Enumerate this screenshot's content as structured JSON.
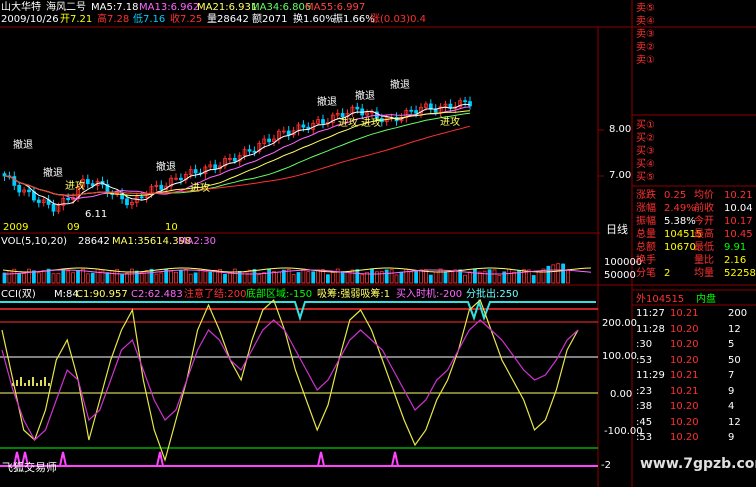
{
  "header": {
    "title": "山大华特",
    "formula": "海风二号",
    "ma5": "MA5:7.18",
    "ma13": "MA13:6.962",
    "ma21": "MA21:6.931",
    "ma34": "MA34:6.806",
    "ma55": "MA55:6.997",
    "date": "2009/10/26",
    "open": "开7.21",
    "high": "高7.28",
    "low": "低7.16",
    "close": "收7.25",
    "vol": "量28642",
    "amount": "额2071",
    "turnover": "换1.60%",
    "amplitude": "振1.66%",
    "change": "涨(0.03)0.4"
  },
  "price_panel": {
    "axis_labels": [
      "8.00",
      "7.00"
    ],
    "low_marker": "6.11",
    "x_labels": [
      "2009",
      "09",
      "10"
    ],
    "period": "日线",
    "annotations": [
      "撤退",
      "进攻",
      "撤退",
      "进攻",
      "撤退",
      "进攻",
      "撤退",
      "进攻",
      "撤退",
      "进攻",
      "撤退",
      "进攻"
    ]
  },
  "volume_panel": {
    "title": "VOL(5,10,20)",
    "value": "28642",
    "ma1": "MA1:35614.398",
    "ma2": "MA2:30",
    "axis_labels": [
      "100000",
      "50000"
    ]
  },
  "cci_panel": {
    "title": "CCI(双)",
    "m": "M:84",
    "c1": "C1:90.957",
    "c2": "C2:62.483",
    "warn": "注意了结:200",
    "bottom": "底部区域:-150",
    "absorb": "吸筹:强弱吸筹:1",
    "buy": "买入时机:-200",
    "sell": "分批出:250",
    "axis_labels": [
      "200.00",
      "100.00",
      "0.00",
      "-100.00",
      "-2"
    ],
    "watermark_left": "飞狐交易师",
    "watermark_right": "www.7gpzb.com"
  },
  "order_book": {
    "sells": [
      "卖⑤",
      "卖④",
      "卖③",
      "卖②",
      "卖①"
    ],
    "buys": [
      "买①",
      "买②",
      "买③",
      "买④",
      "买⑤"
    ],
    "stats": [
      {
        "k1": "涨跌",
        "v1": "0.25",
        "k2": "均价",
        "v2": "10.21",
        "c1": "#ff3030",
        "c2": "#ff3030"
      },
      {
        "k1": "涨幅",
        "v1": "2.49%",
        "k2": "前收",
        "v2": "10.04",
        "c1": "#ff3030",
        "c2": "#ffffff"
      },
      {
        "k1": "振幅",
        "v1": "5.38%",
        "k2": "今开",
        "v2": "10.17",
        "c1": "#ffffff",
        "c2": "#ff3030"
      },
      {
        "k1": "总量",
        "v1": "104515",
        "k2": "最高",
        "v2": "10.45",
        "c1": "#ffff00",
        "c2": "#ff3030"
      },
      {
        "k1": "总额",
        "v1": "10670",
        "k2": "最低",
        "v2": "9.91",
        "c1": "#ffff00",
        "c2": "#00ff00"
      },
      {
        "k1": "换手",
        "v1": "",
        "k2": "量比",
        "v2": "2.16",
        "c1": "#ffff00",
        "c2": "#ffff00"
      },
      {
        "k1": "分笔",
        "v1": "2",
        "k2": "均量",
        "v2": "52258",
        "c1": "#ffff00",
        "c2": "#ffff00"
      }
    ],
    "outer": "外104515",
    "inner": "内盘"
  },
  "ticks": [
    {
      "time": "11:27",
      "price": "10.21",
      "vol": "200"
    },
    {
      "time": "11:28",
      "price": "10.20",
      "vol": "12"
    },
    {
      "time": ":30",
      "price": "10.20",
      "vol": "5"
    },
    {
      "time": ":53",
      "price": "10.20",
      "vol": "50"
    },
    {
      "time": "11:29",
      "price": "10.21",
      "vol": "7"
    },
    {
      "time": ":23",
      "price": "10.21",
      "vol": "9"
    },
    {
      "time": ":38",
      "price": "10.20",
      "vol": "4"
    },
    {
      "time": ":45",
      "price": "10.20",
      "vol": "12"
    },
    {
      "time": ":53",
      "price": "10.20",
      "vol": "9"
    }
  ],
  "colors": {
    "up": "#ff3030",
    "down": "#00ccff",
    "grid": "#8b0000",
    "cci_yellow": "#e6e64a",
    "cci_magenta": "#cc33cc",
    "cyan_line": "#33e0e0"
  }
}
